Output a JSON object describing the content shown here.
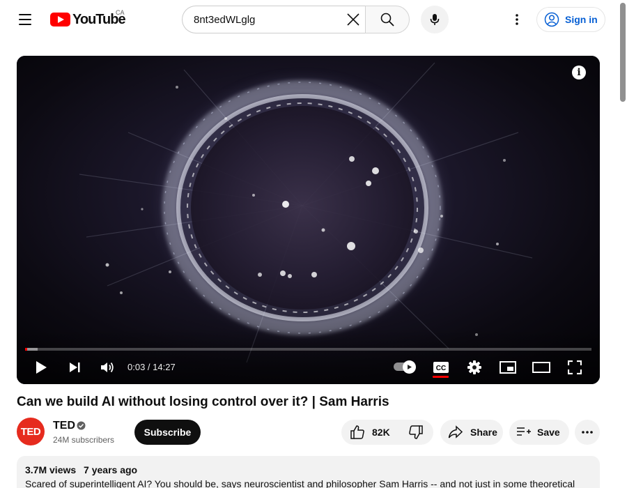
{
  "header": {
    "logo_text": "YouTube",
    "region": "CA",
    "search_value": "8nt3edWLglg",
    "signin_label": "Sign in"
  },
  "player": {
    "current_time": "0:03",
    "duration": "14:27",
    "time_display": "0:03 / 14:27",
    "progress_played": 0.004,
    "progress_loaded": 0.022,
    "autoplay_on": true,
    "captions_on": true
  },
  "video": {
    "title": "Can we build AI without losing control over it? | Sam Harris",
    "channel_name": "TED",
    "channel_avatar_text": "TED",
    "subscribers": "24M subscribers",
    "subscribe_label": "Subscribe",
    "likes": "82K",
    "share_label": "Share",
    "save_label": "Save"
  },
  "description": {
    "views": "3.7M views",
    "age": "7 years ago",
    "text": "Scared of superintelligent AI? You should be, says neuroscientist and philosopher Sam Harris -- and not just in some theoretical"
  },
  "colors": {
    "brand_red": "#ff0000",
    "ted_red": "#e62b1e",
    "link_blue": "#065fd4"
  },
  "icons": [
    "menu-icon",
    "youtube-logo-icon",
    "clear-icon",
    "search-icon",
    "mic-icon",
    "more-vert-icon",
    "account-icon",
    "info-icon",
    "play-icon",
    "next-icon",
    "volume-icon",
    "autoplay-icon",
    "cc-icon",
    "settings-icon",
    "miniplayer-icon",
    "theater-icon",
    "fullscreen-icon",
    "verified-icon",
    "like-icon",
    "dislike-icon",
    "share-icon",
    "save-icon",
    "more-horiz-icon"
  ]
}
